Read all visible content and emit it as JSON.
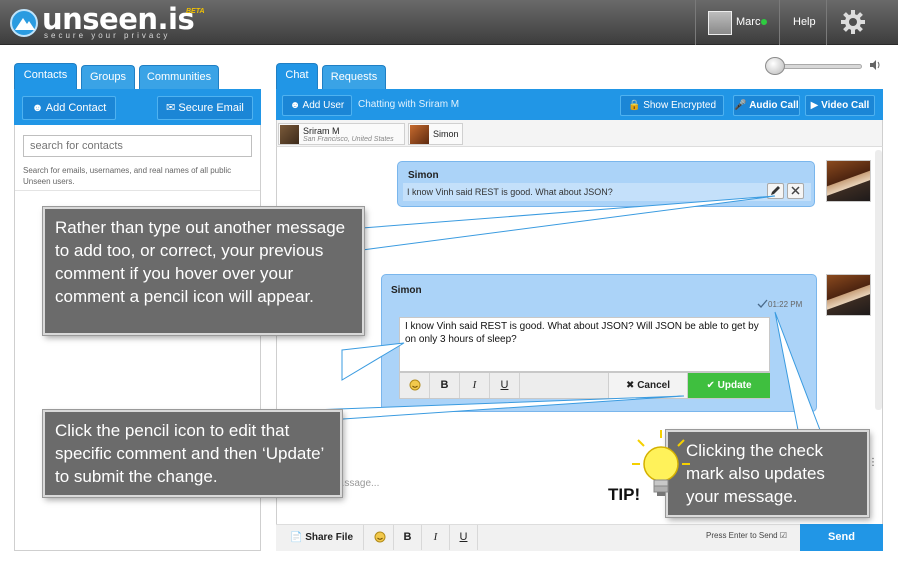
{
  "header": {
    "logo_text": "unseen.is",
    "logo_tagline": "secure your privacy",
    "beta_label": "BETA",
    "user_name": "Marc",
    "help_label": "Help",
    "settings_icon": "gear-icon"
  },
  "left_panel": {
    "tabs": [
      {
        "label": "Contacts",
        "active": true
      },
      {
        "label": "Groups",
        "active": false
      },
      {
        "label": "Communities",
        "active": false
      }
    ],
    "add_contact_label": "Add Contact",
    "secure_email_label": "Secure Email",
    "search_placeholder": "search for contacts",
    "search_help": "Search for emails, usernames, and real names of all public Unseen users."
  },
  "right_panel": {
    "tabs": [
      {
        "label": "Chat",
        "active": true
      },
      {
        "label": "Requests",
        "active": false
      }
    ],
    "add_user_label": "Add User",
    "chatting_with": "Chatting with Sriram M",
    "show_encrypted_label": "Show Encrypted",
    "audio_call_label": "Audio Call",
    "video_call_label": "Video Call",
    "participants": [
      {
        "name": "Sriram M",
        "location": "San Francisco, United States"
      },
      {
        "name": "Simon",
        "location": ""
      }
    ]
  },
  "messages": [
    {
      "sender": "Simon",
      "text": "I know Vinh said REST is good. What about JSON?"
    },
    {
      "sender": "Simon",
      "time": "01:22 PM",
      "edit_text": "I know Vinh said REST is good. What about JSON? Will JSON be able to get by on only 3 hours of sleep?"
    }
  ],
  "editor": {
    "bold": "B",
    "italic": "I",
    "underline": "U",
    "cancel_label": "Cancel",
    "update_label": "Update"
  },
  "compose": {
    "placeholder": "...ssage...",
    "share_file_label": "Share File",
    "bold": "B",
    "italic": "I",
    "underline": "U",
    "press_enter_label": "Press Enter to Send",
    "send_label": "Send"
  },
  "callouts": {
    "pencil_hover": "Rather than type out another message to add too, or correct, your previous comment if you hover over your comment a pencil icon will appear.",
    "click_pencil": "Click the pencil icon to edit that specific comment and then ‘Update’ to submit the change.",
    "check_mark": "Clicking the check mark also updates your message.",
    "tip_label": "TIP!"
  },
  "colors": {
    "primary_blue": "#2196e6",
    "bubble_blue": "#abd3f8",
    "update_green": "#3fbf3f",
    "callout_gray": "#6b6b6b"
  }
}
